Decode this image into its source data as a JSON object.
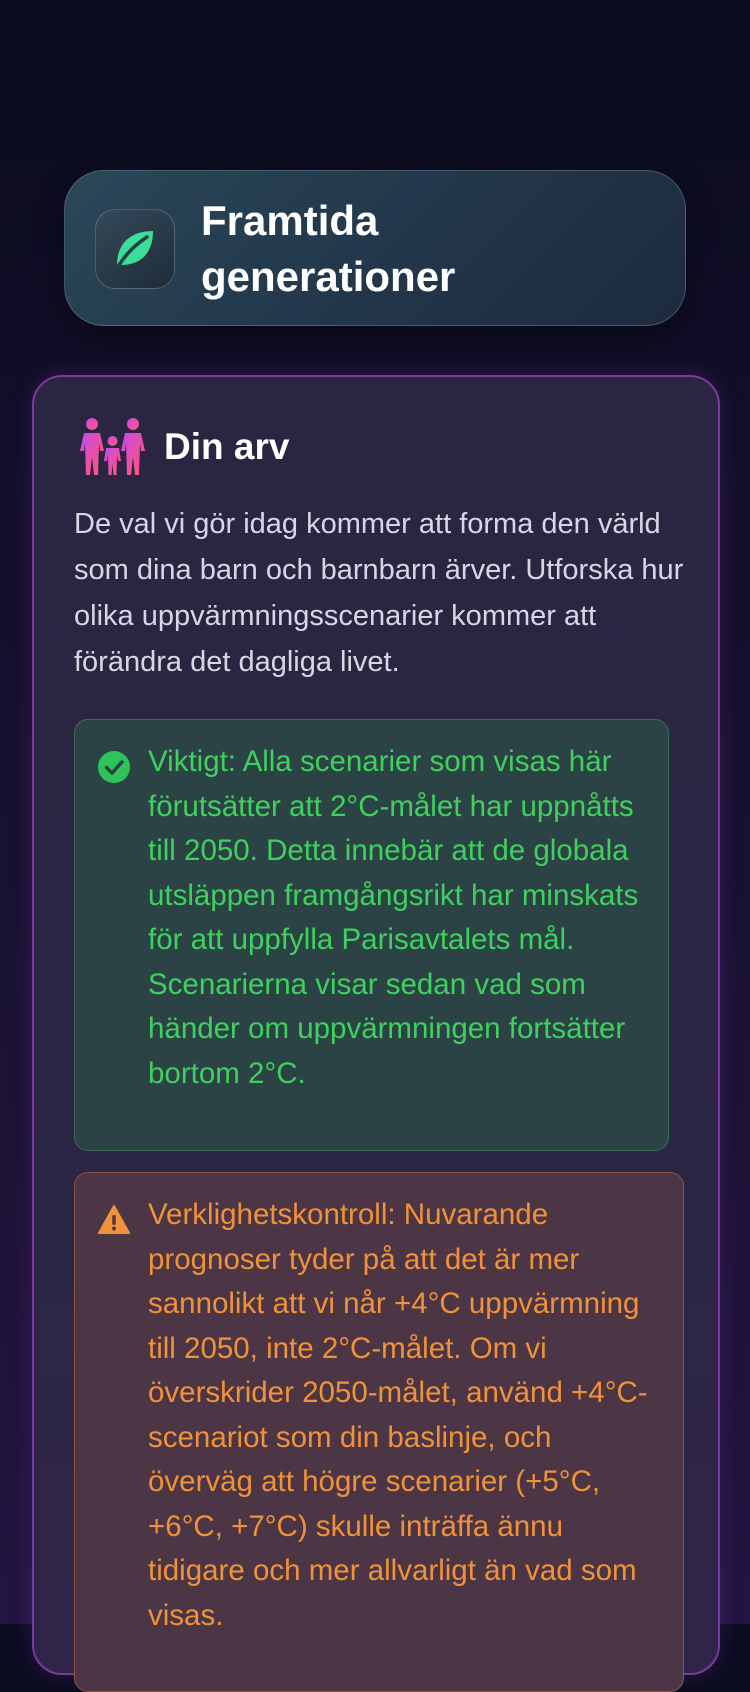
{
  "header": {
    "icon": "leaf-icon",
    "title": "Framtida\ngenerationer"
  },
  "legacy": {
    "icon": "family-icon",
    "title": "Din arv",
    "intro": "De val vi gör idag kommer att forma den värld som dina barn och barnbarn ärver. Utforska hur olika uppvärmningsscenarier kommer att förändra det dagliga livet.",
    "important": {
      "icon": "check-circle-icon",
      "color": "#3fd15e",
      "text": "Viktigt: Alla scenarier som visas här förutsätter att 2°C-målet har uppnåtts till 2050. Detta innebär att de globala utsläppen framgångsrikt har minskats för att uppfylla Parisavtalets mål. Scenarierna visar sedan vad som händer om uppvärmningen fortsätter bortom 2°C."
    },
    "reality_check": {
      "icon": "warning-icon",
      "color": "#f0923a",
      "text": "Verklighetskontroll: Nuvarande prognoser tyder på att det är mer sannolikt att vi når +4°C uppvärmning till 2050, inte 2°C-målet. Om vi överskrider 2050-målet, använd +4°C-scenariot som din baslinje, och överväg att högre scenarier (+5°C, +6°C, +7°C) skulle inträffa ännu tidigare och mer allvarligt än vad som visas."
    }
  }
}
